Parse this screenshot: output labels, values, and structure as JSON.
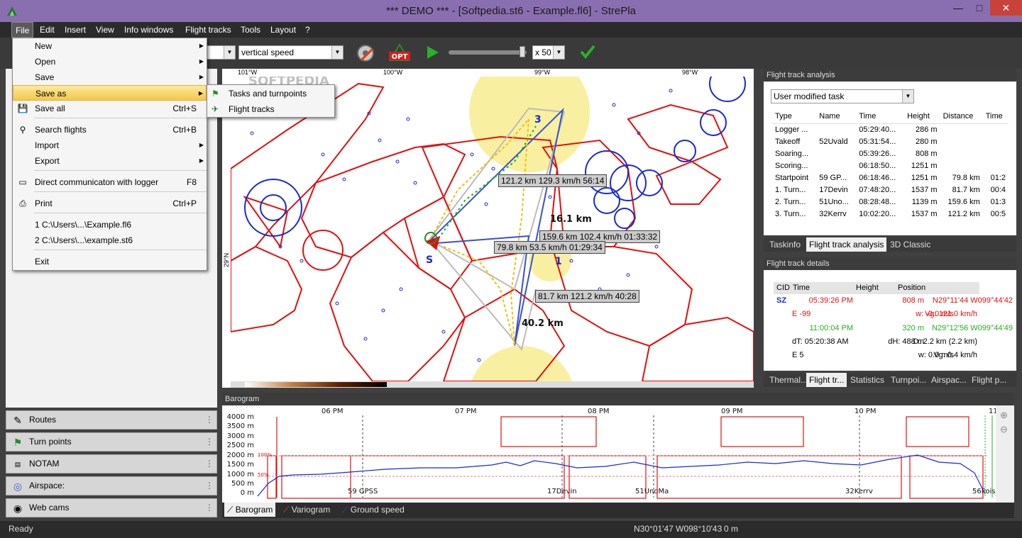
{
  "window": {
    "title": "*** DEMO *** - [Softpedia.st6 - Example.fl6] - StrePla",
    "min": "—",
    "max": "□",
    "close": "✕"
  },
  "menubar": [
    "File",
    "Edit",
    "Insert",
    "View",
    "Info windows",
    "Flight tracks",
    "Tools",
    "Layout",
    "?"
  ],
  "toolbar": {
    "param_select": "vertical speed",
    "speed": "x 50",
    "opt_label": "OPT"
  },
  "file_menu": {
    "items": [
      {
        "label": "New",
        "shortcut": "",
        "sub": true
      },
      {
        "label": "Open",
        "shortcut": "",
        "sub": true
      },
      {
        "label": "Save",
        "shortcut": "",
        "sub": true
      },
      {
        "label": "Save as",
        "shortcut": "",
        "sub": true
      },
      {
        "label": "Save all",
        "shortcut": "Ctrl+S",
        "sub": false
      },
      {
        "label": "Search flights",
        "shortcut": "Ctrl+B",
        "sub": false
      },
      {
        "label": "Import",
        "shortcut": "",
        "sub": true
      },
      {
        "label": "Export",
        "shortcut": "",
        "sub": true
      },
      {
        "label": "Direct communicaton with logger",
        "shortcut": "F8",
        "sub": false
      },
      {
        "label": "Print",
        "shortcut": "Ctrl+P",
        "sub": false
      },
      {
        "label": "1 C:\\Users\\...\\Example.fl6",
        "shortcut": "",
        "sub": false
      },
      {
        "label": "2 C:\\Users\\...\\example.st6",
        "shortcut": "",
        "sub": false
      },
      {
        "label": "Exit",
        "shortcut": "",
        "sub": false
      }
    ],
    "submenu": [
      "Tasks and turnpoints",
      "Flight tracks"
    ]
  },
  "nav": [
    "Routes",
    "Turn points",
    "NOTAM",
    "Airspace:",
    "Web cams"
  ],
  "map": {
    "lon_labels": [
      "101°W",
      "100°W",
      "99°W",
      "98°W"
    ],
    "lat_label": "29°N",
    "watermark": "SOFTPEDIA",
    "labels": [
      "121.2 km 129.3 km/h 56:14",
      "159.6 km 102.4 km/h 01:33:32",
      "79.8 km  53.5 km/h 01:29:34",
      "81.7 km 121.2 km/h 40:28"
    ],
    "dist": [
      "16.1 km",
      "40.2 km"
    ],
    "points": [
      "3",
      "1",
      "S"
    ]
  },
  "analysis": {
    "title": "Flight track analysis",
    "task": "User modified task",
    "columns": [
      "Type",
      "Name",
      "Time",
      "Height",
      "Distance",
      "Time"
    ],
    "rows": [
      [
        "Logger ...",
        "",
        "05:29:40...",
        "286 m",
        "",
        ""
      ],
      [
        "Takeoff",
        "52Uvald",
        "05:31:54...",
        "280 m",
        "",
        ""
      ],
      [
        "Soaring...",
        "",
        "05:39:26...",
        "808 m",
        "",
        ""
      ],
      [
        "Scoring...",
        "",
        "06:18:50...",
        "1251 m",
        "",
        ""
      ],
      [
        "Startpoint",
        "59 GP...",
        "06:18:46...",
        "1251 m",
        "79.8 km",
        "01:2"
      ],
      [
        "1. Turn...",
        "17Devin",
        "07:48:20...",
        "1537 m",
        "81.7 km",
        "00:4"
      ],
      [
        "2. Turn...",
        "51Uno...",
        "08:28:48...",
        "1139 m",
        "159.6 km",
        "01:3"
      ],
      [
        "3. Turn...",
        "32Kerrv",
        "10:02:20...",
        "1537 m",
        "121.2 km",
        "00:5"
      ]
    ],
    "tabs": [
      "Taskinfo",
      "Flight track analysis",
      "3D Classic"
    ]
  },
  "details": {
    "title": "Flight track details",
    "columns": [
      "CID",
      "Time",
      "Height",
      "Position"
    ],
    "rows": [
      {
        "a": "SZ",
        "b": "05:39:26 PM",
        "c": "808 m",
        "d": "N29°11'44 W099°44'42"
      },
      {
        "a": "E -99",
        "b": "",
        "c": "w: -0.0 m/s",
        "d": "Vg: 121.0 km/h"
      },
      {
        "a": "",
        "b": "11:00:04 PM",
        "c": "320 m",
        "d": "N29°12'56 W099°44'49"
      },
      {
        "a": "dT: 05:20:38 AM",
        "b": "",
        "c": "dH: 488 m",
        "d": "D: 2.2 km (2.2 km)"
      },
      {
        "a": "E 5",
        "b": "",
        "c": "w: 0.0 m/s",
        "d": "Vg: 0.4 km/h"
      }
    ],
    "tabs": [
      "Thermal...",
      "Flight tr...",
      "Statistics",
      "Turnpoi...",
      "Airspac...",
      "Flight p..."
    ]
  },
  "barogram": {
    "title": "Barogram",
    "x_ticks": [
      "06 PM",
      "07 PM",
      "08 PM",
      "09 PM",
      "10 PM",
      "11"
    ],
    "y_ticks": [
      "4000 m",
      "3500 m",
      "3000 m",
      "2500 m",
      "2000 m",
      "1500 m",
      "1000 m",
      "500 m",
      "0 m"
    ],
    "pct": [
      "100%",
      "50%"
    ],
    "turnpoints": [
      "59 GPSS",
      "17Devin",
      "51UnoMa",
      "32Kerrv",
      "56Pois"
    ],
    "tabs": [
      "Barogram",
      "Variogram",
      "Ground speed"
    ]
  },
  "status": {
    "left": "Ready",
    "coords": "N30°01'47 W098°10'43",
    "alt": "0 m"
  },
  "colors": {
    "airspace": "#e01010",
    "track": "#1a2ad0",
    "thermal": "#f8f0a0",
    "accent": "#f4c84a"
  }
}
